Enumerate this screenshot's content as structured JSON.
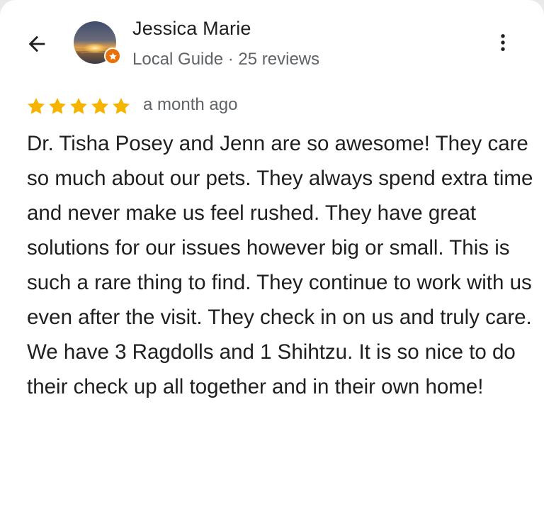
{
  "reviewer": {
    "name": "Jessica Marie",
    "meta": "Local Guide · 25 reviews",
    "avatar_icon": "sunset-avatar-icon",
    "badge_icon": "local-guide-star-icon"
  },
  "review": {
    "rating": 5,
    "rating_max": 5,
    "time_ago": "a month ago",
    "paragraphs": [
      "Dr. Tisha Posey and Jenn are so awesome! They care so much about our pets. They always spend extra time and never make us feel rushed. They have great solutions for our issues however big or small. This is such a rare thing to find. They continue to work with us even after the visit. They check in on us and truly care.",
      "We have 3 Ragdolls and 1 Shihtzu. It is so nice to do their check up all together and in their own home!"
    ]
  },
  "icons": {
    "back": "arrow-back-icon",
    "more": "more-vert-icon",
    "star": "star-icon"
  },
  "colors": {
    "star": "#f4b400",
    "badge": "#e8710a",
    "text_primary": "#1f1f1f",
    "text_secondary": "#5f6368"
  }
}
